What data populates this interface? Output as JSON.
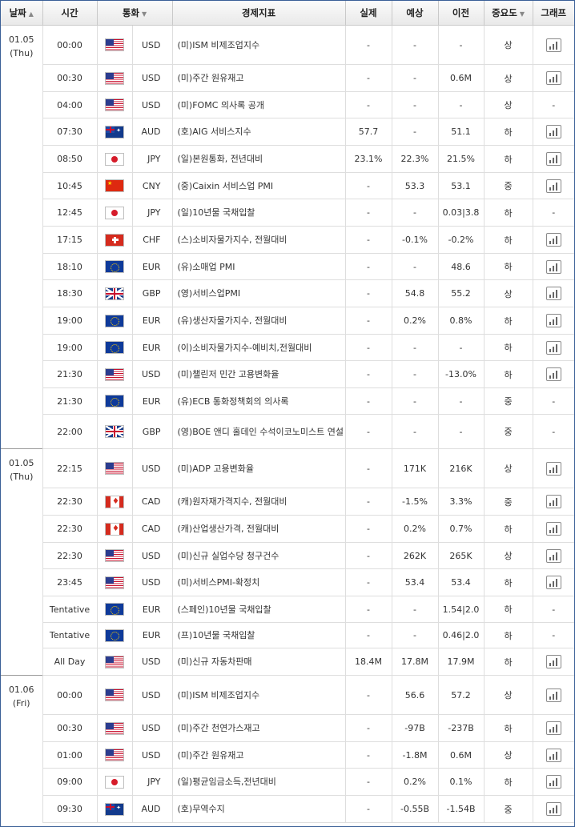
{
  "header": {
    "date": "날짜",
    "time": "시간",
    "currency": "통화",
    "indicator": "경제지표",
    "actual": "실제",
    "forecast": "예상",
    "previous": "이전",
    "importance": "중요도",
    "graph": "그래프"
  },
  "rows": [
    {
      "date": "01.05",
      "day": "(Thu)",
      "time": "00:00",
      "flag": "us",
      "currency": "USD",
      "indicator": "(미)ISM 비제조업지수",
      "actual": "-",
      "forecast": "-",
      "previous": "-",
      "importance": "상",
      "graph": true
    },
    {
      "time": "00:30",
      "flag": "us",
      "currency": "USD",
      "indicator": "(미)주간 원유재고",
      "actual": "-",
      "forecast": "-",
      "previous": "0.6M",
      "importance": "상",
      "graph": true
    },
    {
      "time": "04:00",
      "flag": "us",
      "currency": "USD",
      "indicator": "(미)FOMC 의사록 공개",
      "actual": "-",
      "forecast": "-",
      "previous": "-",
      "importance": "상",
      "graph": false
    },
    {
      "time": "07:30",
      "flag": "au",
      "currency": "AUD",
      "indicator": "(호)AIG 서비스지수",
      "actual": "57.7",
      "forecast": "-",
      "previous": "51.1",
      "importance": "하",
      "graph": true
    },
    {
      "time": "08:50",
      "flag": "jp",
      "currency": "JPY",
      "indicator": "(일)본원통화, 전년대비",
      "actual": "23.1%",
      "forecast": "22.3%",
      "previous": "21.5%",
      "importance": "하",
      "graph": true
    },
    {
      "time": "10:45",
      "flag": "cn",
      "currency": "CNY",
      "indicator": "(중)Caixin 서비스업 PMI",
      "actual": "-",
      "forecast": "53.3",
      "previous": "53.1",
      "importance": "중",
      "graph": true
    },
    {
      "time": "12:45",
      "flag": "jp",
      "currency": "JPY",
      "indicator": "(일)10년물 국채입찰",
      "actual": "-",
      "forecast": "-",
      "previous": "0.03|3.8",
      "importance": "하",
      "graph": false
    },
    {
      "time": "17:15",
      "flag": "ch",
      "currency": "CHF",
      "indicator": "(스)소비자물가지수, 전월대비",
      "actual": "-",
      "forecast": "-0.1%",
      "previous": "-0.2%",
      "importance": "하",
      "graph": true
    },
    {
      "time": "18:10",
      "flag": "eu",
      "currency": "EUR",
      "indicator": "(유)소매업 PMI",
      "actual": "-",
      "forecast": "-",
      "previous": "48.6",
      "importance": "하",
      "graph": true
    },
    {
      "time": "18:30",
      "flag": "gb",
      "currency": "GBP",
      "indicator": "(영)서비스업PMI",
      "actual": "-",
      "forecast": "54.8",
      "previous": "55.2",
      "importance": "상",
      "graph": true
    },
    {
      "time": "19:00",
      "flag": "eu",
      "currency": "EUR",
      "indicator": "(유)생산자물가지수, 전월대비",
      "actual": "-",
      "forecast": "0.2%",
      "previous": "0.8%",
      "importance": "하",
      "graph": true
    },
    {
      "time": "19:00",
      "flag": "eu",
      "currency": "EUR",
      "indicator": "(이)소비자물가지수-예비치,전월대비",
      "actual": "-",
      "forecast": "-",
      "previous": "-",
      "importance": "하",
      "graph": true
    },
    {
      "time": "21:30",
      "flag": "us",
      "currency": "USD",
      "indicator": "(미)챌린저 민간 고용변화율",
      "actual": "-",
      "forecast": "-",
      "previous": "-13.0%",
      "importance": "하",
      "graph": true
    },
    {
      "time": "21:30",
      "flag": "eu",
      "currency": "EUR",
      "indicator": "(유)ECB 통화정책회의 의사록",
      "actual": "-",
      "forecast": "-",
      "previous": "-",
      "importance": "중",
      "graph": false
    },
    {
      "time": "22:00",
      "flag": "gb",
      "currency": "GBP",
      "indicator": "(영)BOE 앤디 홀데인 수석이코노미스트 연설",
      "actual": "-",
      "forecast": "-",
      "previous": "-",
      "importance": "중",
      "graph": false,
      "tall": true
    },
    {
      "date": "01.05",
      "day": "(Thu)",
      "time": "22:15",
      "flag": "us",
      "currency": "USD",
      "indicator": "(미)ADP 고용변화율",
      "actual": "-",
      "forecast": "171K",
      "previous": "216K",
      "importance": "상",
      "graph": true
    },
    {
      "time": "22:30",
      "flag": "ca",
      "currency": "CAD",
      "indicator": "(캐)원자재가격지수, 전월대비",
      "actual": "-",
      "forecast": "-1.5%",
      "previous": "3.3%",
      "importance": "중",
      "graph": true
    },
    {
      "time": "22:30",
      "flag": "ca",
      "currency": "CAD",
      "indicator": "(캐)산업생산가격, 전월대비",
      "actual": "-",
      "forecast": "0.2%",
      "previous": "0.7%",
      "importance": "하",
      "graph": true
    },
    {
      "time": "22:30",
      "flag": "us",
      "currency": "USD",
      "indicator": "(미)신규 실업수당 청구건수",
      "actual": "-",
      "forecast": "262K",
      "previous": "265K",
      "importance": "상",
      "graph": true
    },
    {
      "time": "23:45",
      "flag": "us",
      "currency": "USD",
      "indicator": "(미)서비스PMI-확정치",
      "actual": "-",
      "forecast": "53.4",
      "previous": "53.4",
      "importance": "하",
      "graph": true
    },
    {
      "time": "Tentative",
      "flag": "eu",
      "currency": "EUR",
      "indicator": "(스페인)10년물 국채입찰",
      "actual": "-",
      "forecast": "-",
      "previous": "1.54|2.0",
      "importance": "하",
      "graph": false
    },
    {
      "time": "Tentative",
      "flag": "eu",
      "currency": "EUR",
      "indicator": "(프)10년물 국채입찰",
      "actual": "-",
      "forecast": "-",
      "previous": "0.46|2.0",
      "importance": "하",
      "graph": false
    },
    {
      "time": "All Day",
      "flag": "us",
      "currency": "USD",
      "indicator": "(미)신규 자동차판매",
      "actual": "18.4M",
      "forecast": "17.8M",
      "previous": "17.9M",
      "importance": "하",
      "graph": true
    },
    {
      "date": "01.06",
      "day": "(Fri)",
      "time": "00:00",
      "flag": "us",
      "currency": "USD",
      "indicator": "(미)ISM 비제조업지수",
      "actual": "-",
      "forecast": "56.6",
      "previous": "57.2",
      "importance": "상",
      "graph": true
    },
    {
      "time": "00:30",
      "flag": "us",
      "currency": "USD",
      "indicator": "(미)주간 천연가스재고",
      "actual": "-",
      "forecast": "-97B",
      "previous": "-237B",
      "importance": "하",
      "graph": true
    },
    {
      "time": "01:00",
      "flag": "us",
      "currency": "USD",
      "indicator": "(미)주간 원유재고",
      "actual": "-",
      "forecast": "-1.8M",
      "previous": "0.6M",
      "importance": "상",
      "graph": true
    },
    {
      "time": "09:00",
      "flag": "jp",
      "currency": "JPY",
      "indicator": "(일)평균임금소득,전년대비",
      "actual": "-",
      "forecast": "0.2%",
      "previous": "0.1%",
      "importance": "하",
      "graph": true
    },
    {
      "time": "09:30",
      "flag": "au",
      "currency": "AUD",
      "indicator": "(호)무역수지",
      "actual": "-",
      "forecast": "-0.55B",
      "previous": "-1.54B",
      "importance": "중",
      "graph": true
    }
  ]
}
